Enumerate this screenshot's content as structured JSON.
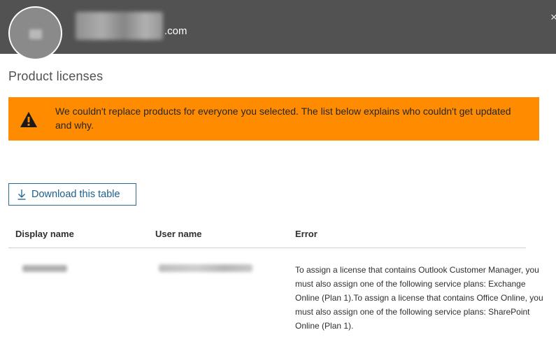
{
  "header": {
    "email_suffix": ".com",
    "close_glyph": "×"
  },
  "page": {
    "title": "Product licenses"
  },
  "alert": {
    "icon": "warning-icon",
    "message": "We couldn't replace products for everyone you selected. The list below explains who couldn't get updated and why.",
    "background_color": "#ff8c00"
  },
  "actions": {
    "download_label": "Download this table",
    "download_icon": "download-arrow-icon"
  },
  "table": {
    "columns": [
      "Display name",
      "User name",
      "Error"
    ],
    "rows": [
      {
        "display_name": "",
        "user_name": "",
        "error": "To assign a license that contains Outlook Customer Manager, you must also assign one of the following service plans: Exchange Online (Plan 1).To assign a license that contains Office Online, you must also assign one of the following service plans: SharePoint Online (Plan 1)."
      }
    ]
  },
  "colors": {
    "header_bg": "#525252",
    "accent": "#1b5f8c"
  }
}
